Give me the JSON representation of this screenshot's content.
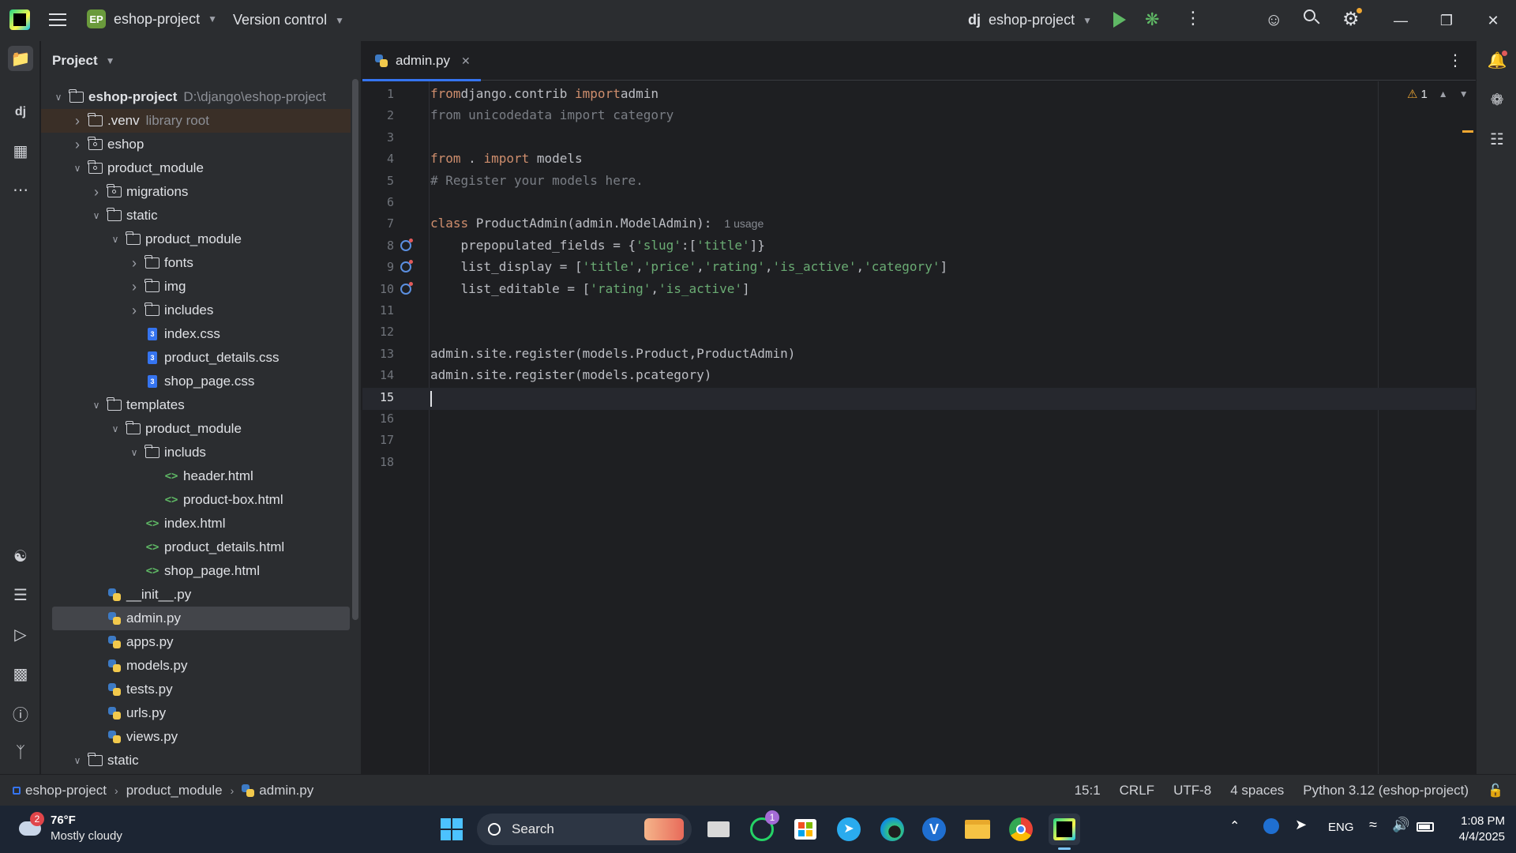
{
  "titlebar": {
    "project_badge": "EP",
    "project_name": "eshop-project",
    "vcs_label": "Version control",
    "run_config_badge": "dj",
    "run_config_name": "eshop-project"
  },
  "project_panel": {
    "title": "Project",
    "tree": [
      {
        "label": "eshop-project",
        "hint": "D:\\django\\eshop-project",
        "icon": "folder-icon",
        "depth": 0,
        "arrow": "open"
      },
      {
        "label": ".venv",
        "hint": "library root",
        "icon": "folder-icon",
        "depth": 1,
        "arrow": "closed"
      },
      {
        "label": "eshop",
        "hint": "",
        "icon": "package-icon",
        "depth": 1,
        "arrow": "closed"
      },
      {
        "label": "product_module",
        "hint": "",
        "icon": "package-icon",
        "depth": 1,
        "arrow": "open"
      },
      {
        "label": "migrations",
        "hint": "",
        "icon": "package-icon",
        "depth": 2,
        "arrow": "closed"
      },
      {
        "label": "static",
        "hint": "",
        "icon": "folder-icon",
        "depth": 2,
        "arrow": "open"
      },
      {
        "label": "product_module",
        "hint": "",
        "icon": "folder-icon",
        "depth": 3,
        "arrow": "open"
      },
      {
        "label": "fonts",
        "hint": "",
        "icon": "folder-icon",
        "depth": 4,
        "arrow": "closed"
      },
      {
        "label": "img",
        "hint": "",
        "icon": "folder-icon",
        "depth": 4,
        "arrow": "closed"
      },
      {
        "label": "includes",
        "hint": "",
        "icon": "folder-icon",
        "depth": 4,
        "arrow": "closed"
      },
      {
        "label": "index.css",
        "hint": "",
        "icon": "css-file-icon",
        "depth": 4,
        "arrow": "none"
      },
      {
        "label": "product_details.css",
        "hint": "",
        "icon": "css-file-icon",
        "depth": 4,
        "arrow": "none"
      },
      {
        "label": "shop_page.css",
        "hint": "",
        "icon": "css-file-icon",
        "depth": 4,
        "arrow": "none"
      },
      {
        "label": "templates",
        "hint": "",
        "icon": "folder-icon",
        "depth": 2,
        "arrow": "open"
      },
      {
        "label": "product_module",
        "hint": "",
        "icon": "folder-icon",
        "depth": 3,
        "arrow": "open"
      },
      {
        "label": "includs",
        "hint": "",
        "icon": "folder-icon",
        "depth": 4,
        "arrow": "open"
      },
      {
        "label": "header.html",
        "hint": "",
        "icon": "html-file-icon",
        "depth": 5,
        "arrow": "none"
      },
      {
        "label": "product-box.html",
        "hint": "",
        "icon": "html-file-icon",
        "depth": 5,
        "arrow": "none"
      },
      {
        "label": "index.html",
        "hint": "",
        "icon": "html-file-icon",
        "depth": 4,
        "arrow": "none"
      },
      {
        "label": "product_details.html",
        "hint": "",
        "icon": "html-file-icon",
        "depth": 4,
        "arrow": "none"
      },
      {
        "label": "shop_page.html",
        "hint": "",
        "icon": "html-file-icon",
        "depth": 4,
        "arrow": "none"
      },
      {
        "label": "__init__.py",
        "hint": "",
        "icon": "python-file-icon",
        "depth": 2,
        "arrow": "none"
      },
      {
        "label": "admin.py",
        "hint": "",
        "icon": "python-file-icon",
        "depth": 2,
        "arrow": "none",
        "selected": true
      },
      {
        "label": "apps.py",
        "hint": "",
        "icon": "python-file-icon",
        "depth": 2,
        "arrow": "none"
      },
      {
        "label": "models.py",
        "hint": "",
        "icon": "python-file-icon",
        "depth": 2,
        "arrow": "none"
      },
      {
        "label": "tests.py",
        "hint": "",
        "icon": "python-file-icon",
        "depth": 2,
        "arrow": "none"
      },
      {
        "label": "urls.py",
        "hint": "",
        "icon": "python-file-icon",
        "depth": 2,
        "arrow": "none"
      },
      {
        "label": "views.py",
        "hint": "",
        "icon": "python-file-icon",
        "depth": 2,
        "arrow": "none"
      },
      {
        "label": "static",
        "hint": "",
        "icon": "folder-icon",
        "depth": 1,
        "arrow": "open"
      }
    ]
  },
  "editor": {
    "tab_label": "admin.py",
    "warnings_count": "1",
    "current_line": 15,
    "lines": [
      {
        "n": "1",
        "tokens": [
          [
            "kw",
            "from"
          ],
          [
            "",
            "django.contrib "
          ],
          [
            "kw",
            "import"
          ],
          [
            "",
            "admin"
          ]
        ]
      },
      {
        "n": "2",
        "tokens": [
          [
            "cm",
            "from unicodedata import category"
          ]
        ]
      },
      {
        "n": "3",
        "tokens": []
      },
      {
        "n": "4",
        "tokens": [
          [
            "kw",
            "from"
          ],
          [
            "",
            " . "
          ],
          [
            "kw",
            "import"
          ],
          [
            "",
            " models"
          ]
        ]
      },
      {
        "n": "5",
        "tokens": [
          [
            "cm",
            "# Register your models here."
          ]
        ]
      },
      {
        "n": "6",
        "tokens": []
      },
      {
        "n": "7",
        "tokens": [
          [
            "kw",
            "class"
          ],
          [
            "",
            " ProductAdmin(admin.ModelAdmin):"
          ]
        ],
        "hint": "1 usage"
      },
      {
        "n": "8",
        "gutter_icon": true,
        "tokens": [
          [
            "",
            "    prepopulated_fields = {"
          ],
          [
            "str",
            "'slug'"
          ],
          [
            "",
            ":["
          ],
          [
            "str",
            "'title'"
          ],
          [
            "",
            "]}"
          ]
        ]
      },
      {
        "n": "9",
        "gutter_icon": true,
        "tokens": [
          [
            "",
            "    list_display = ["
          ],
          [
            "str",
            "'title'"
          ],
          [
            "",
            ","
          ],
          [
            "str",
            "'price'"
          ],
          [
            "",
            ","
          ],
          [
            "str",
            "'rating'"
          ],
          [
            "",
            ","
          ],
          [
            "str",
            "'is_active'"
          ],
          [
            "",
            ","
          ],
          [
            "str",
            "'category'"
          ],
          [
            "",
            "]"
          ]
        ]
      },
      {
        "n": "10",
        "gutter_icon": true,
        "tokens": [
          [
            "",
            "    list_editable = ["
          ],
          [
            "str",
            "'rating'"
          ],
          [
            "",
            ","
          ],
          [
            "str",
            "'is_active'"
          ],
          [
            "",
            "]"
          ]
        ]
      },
      {
        "n": "11",
        "tokens": []
      },
      {
        "n": "12",
        "tokens": []
      },
      {
        "n": "13",
        "tokens": [
          [
            "",
            "admin.site.register(models.Product,ProductAdmin)"
          ]
        ]
      },
      {
        "n": "14",
        "tokens": [
          [
            "",
            "admin.site.register(models.pcategory)"
          ]
        ]
      },
      {
        "n": "15",
        "tokens": []
      },
      {
        "n": "16",
        "tokens": []
      },
      {
        "n": "17",
        "tokens": []
      },
      {
        "n": "18",
        "tokens": []
      }
    ]
  },
  "statusbar": {
    "breadcrumb": [
      "eshop-project",
      "product_module",
      "admin.py"
    ],
    "position": "15:1",
    "line_ending": "CRLF",
    "encoding": "UTF-8",
    "indent": "4 spaces",
    "interpreter": "Python 3.12 (eshop-project)"
  },
  "taskbar": {
    "weather_temp": "76°F",
    "weather_desc": "Mostly cloudy",
    "weather_badge": "2",
    "search_label": "Search",
    "whatsapp_badge": "1",
    "language": "ENG",
    "time": "1:08 PM",
    "date": "4/4/2025"
  },
  "colors": {
    "accent": "#3574f0",
    "keyword": "#cf8e6d",
    "string": "#6aab73",
    "comment": "#7a7e85"
  }
}
